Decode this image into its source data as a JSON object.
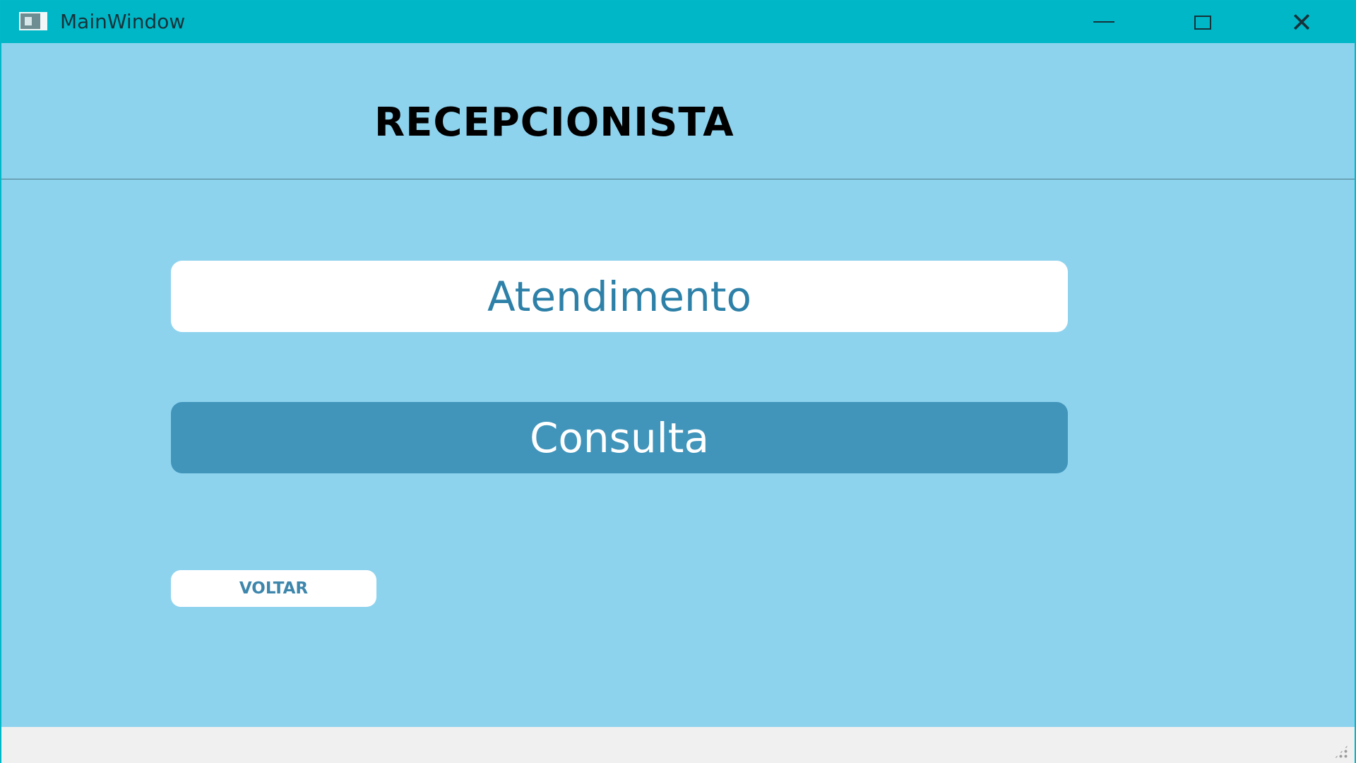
{
  "window": {
    "title": "MainWindow",
    "controls": {
      "minimize": "—",
      "maximize": "□",
      "close": "✕"
    }
  },
  "header": {
    "title": "RECEPCIONISTA"
  },
  "menu": {
    "atendimento_label": "Atendimento",
    "consulta_label": "Consulta",
    "voltar_label": "VOLTAR"
  },
  "colors": {
    "titlebar": "#00b7c7",
    "background": "#8ed3ee",
    "primary_button": "#4195bb",
    "button_text": "#2d80a8",
    "statusbar": "#f0f0f0"
  },
  "icons": {
    "app": "window-app-icon",
    "minimize": "minimize-icon",
    "maximize": "maximize-icon",
    "close": "close-icon",
    "size_grip": "size-grip-icon"
  }
}
